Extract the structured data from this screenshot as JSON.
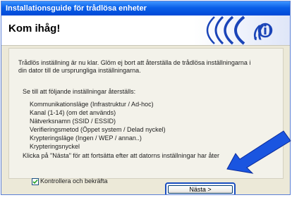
{
  "window": {
    "title": "Installationsguide för trådlösa enheter"
  },
  "header": {
    "title": "Kom ihåg!"
  },
  "content": {
    "intro_line1": "Trådlös inställning är nu klar. Glöm ej bort att återställa de trådlösa inställningarna i",
    "intro_line2": "din dator till de ursprungliga inställningarna.",
    "list_title": "Se till att följande inställningar återställs:",
    "items": [
      "Kommunikationsläge (Infrastruktur / Ad-hoc)",
      "Kanal (1-14) (om det används)",
      "Nätverksnamn (SSID / ESSID)",
      "Verifieringsmetod (Öppet system / Delad nyckel)",
      "Krypteringsläge (Ingen / WEP / annan..)",
      "Krypteringsnyckel"
    ],
    "next_instruction": "Klicka på \"Nästa\" för att fortsätta efter att datorns inställningar har åter"
  },
  "footer": {
    "checkbox_label": "Kontrollera och bekräfta",
    "checkbox_checked": true,
    "next_button": "Nästa >"
  },
  "colors": {
    "titlebar": "#0a5fe8",
    "logo_blue": "#1a44b8",
    "arrow_blue": "#1a55e0",
    "panel_bg": "#ece9d8"
  },
  "icons": {
    "logo": "wireless-signal-icon",
    "arrow": "pointer-arrow-icon"
  }
}
